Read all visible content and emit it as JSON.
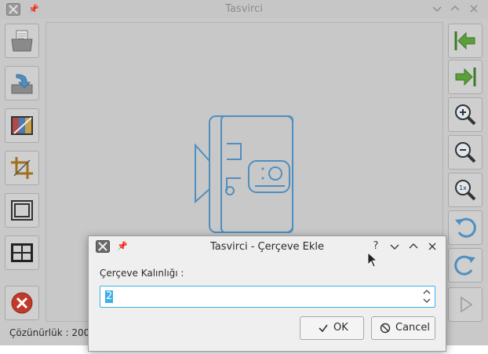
{
  "main_window": {
    "title": "Tasvirci",
    "status_text": "Çözünürlük : 200",
    "left_toolbar": [
      {
        "name": "open-file-icon"
      },
      {
        "name": "save-file-icon"
      },
      {
        "name": "color-adjust-icon"
      },
      {
        "name": "crop-icon"
      },
      {
        "name": "frame-icon"
      },
      {
        "name": "grid-icon"
      },
      {
        "name": "close-image-icon"
      }
    ],
    "right_toolbar": [
      {
        "name": "first-image-icon"
      },
      {
        "name": "last-image-icon"
      },
      {
        "name": "zoom-in-icon"
      },
      {
        "name": "zoom-out-icon"
      },
      {
        "name": "zoom-reset-icon",
        "glyph": "1x"
      },
      {
        "name": "rotate-left-icon"
      },
      {
        "name": "rotate-right-icon"
      },
      {
        "name": "play-icon"
      }
    ]
  },
  "dialog": {
    "title": "Tasvirci - Çerçeve Ekle",
    "help_glyph": "?",
    "field_label": "Çerçeve Kalınlığı :",
    "thickness_value": "2",
    "ok_label": "OK",
    "cancel_label": "Cancel"
  },
  "colors": {
    "accent": "#3daee9",
    "icon_blue": "#4f8fc0",
    "icon_green": "#5b9e3a",
    "close_red": "#c0392b"
  }
}
